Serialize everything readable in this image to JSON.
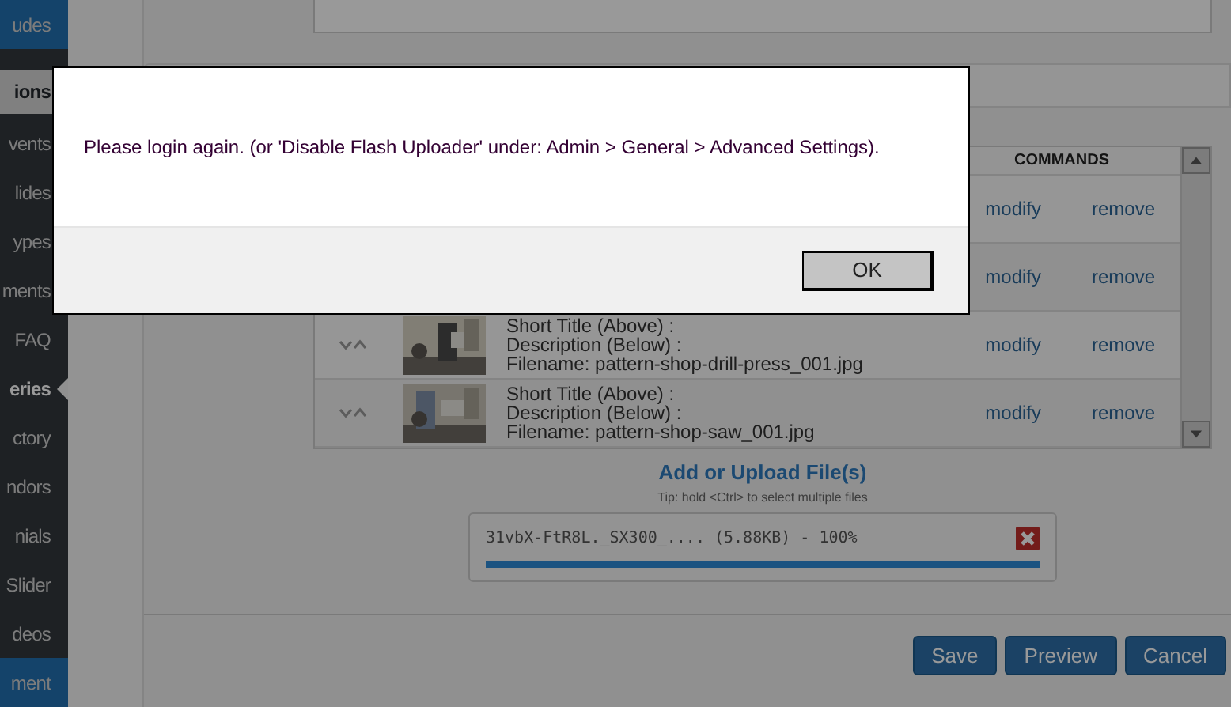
{
  "sidebar": {
    "items": [
      {
        "label": "udes",
        "kind": "top",
        "selected": false
      },
      {
        "label": "ions",
        "kind": "section",
        "selected": false
      },
      {
        "label": "vents",
        "kind": "item",
        "selected": false
      },
      {
        "label": "lides",
        "kind": "item",
        "selected": false
      },
      {
        "label": "ypes",
        "kind": "item",
        "selected": false
      },
      {
        "label": "ments",
        "kind": "item",
        "selected": false
      },
      {
        "label": "FAQ",
        "kind": "item",
        "selected": false
      },
      {
        "label": "eries",
        "kind": "item",
        "selected": true
      },
      {
        "label": "ctory",
        "kind": "item",
        "selected": false
      },
      {
        "label": "ndors",
        "kind": "item",
        "selected": false
      },
      {
        "label": "nials",
        "kind": "item",
        "selected": false
      },
      {
        "label": "Slider",
        "kind": "item",
        "selected": false
      },
      {
        "label": "deos",
        "kind": "item",
        "selected": false
      },
      {
        "label": "ment",
        "kind": "top",
        "selected": false
      }
    ]
  },
  "table": {
    "columns": [
      "COMMANDS"
    ],
    "rows": [
      {
        "modify": "modify",
        "remove": "remove"
      },
      {
        "modify": "modify",
        "remove": "remove"
      },
      {
        "thumbnail": {
          "kind": "picture"
        },
        "lines": [
          "Short Title (Above) :",
          "Description (Below) :",
          "Filename: pattern-shop-drill-press_001.jpg"
        ],
        "modify": "modify",
        "remove": "remove"
      },
      {
        "thumbnail": {
          "kind": "picture"
        },
        "lines": [
          "Short Title (Above) :",
          "Description (Below) :",
          "Filename: pattern-shop-saw_001.jpg"
        ],
        "modify": "modify",
        "remove": "remove"
      }
    ]
  },
  "upload": {
    "title": "Add or Upload File(s)",
    "tip": "Tip: hold <Ctrl> to select multiple files",
    "file": {
      "text": "31vbX-FtR8L._SX300_.... (5.88KB) - 100%",
      "level": 1
    }
  },
  "buttons": [
    "Save",
    "Preview",
    "Cancel"
  ],
  "dialog": {
    "message": "Please login again. (or 'Disable Flash Uploader' under: Admin > General > Advanced Settings).",
    "button": "OK"
  }
}
